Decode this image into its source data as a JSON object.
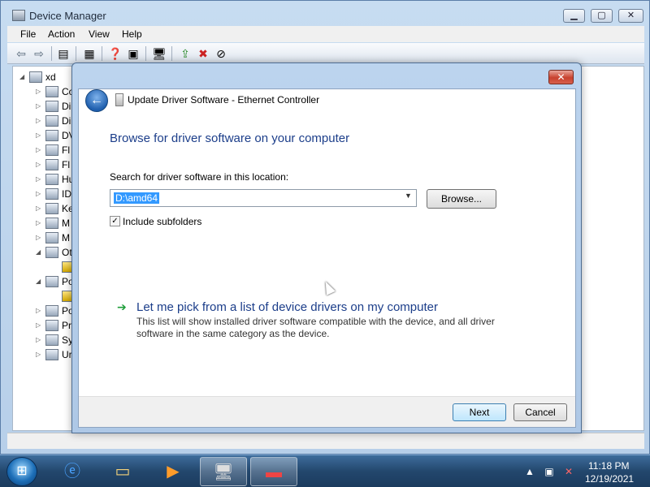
{
  "device_manager": {
    "title": "Device Manager",
    "menu": [
      "File",
      "Action",
      "View",
      "Help"
    ],
    "tree_root": "xd",
    "tree_items": [
      "Co",
      "Di",
      "Di",
      "DV",
      "Fl",
      "Fl",
      "Hu",
      "ID",
      "Ke",
      "M",
      "M",
      "Ot",
      "Po",
      "Po",
      "Pr",
      "Sy",
      "Ur"
    ]
  },
  "dialog": {
    "title": "Update Driver Software - Ethernet Controller",
    "heading": "Browse for driver software on your computer",
    "search_label": "Search for driver software in this location:",
    "path_value": "D:\\amd64",
    "browse_label": "Browse...",
    "include_subfolders_label": "Include subfolders",
    "include_subfolders_checked": true,
    "pick_title": "Let me pick from a list of device drivers on my computer",
    "pick_desc": "This list will show installed driver software compatible with the device, and all driver software in the same category as the device.",
    "next_label": "Next",
    "cancel_label": "Cancel"
  },
  "taskbar": {
    "time": "11:18 PM",
    "date": "12/19/2021"
  },
  "colors": {
    "heading_blue": "#1c3e8a",
    "selection_blue": "#3399ff",
    "close_red": "#c8412e",
    "green_arrow": "#1f9e3a"
  }
}
